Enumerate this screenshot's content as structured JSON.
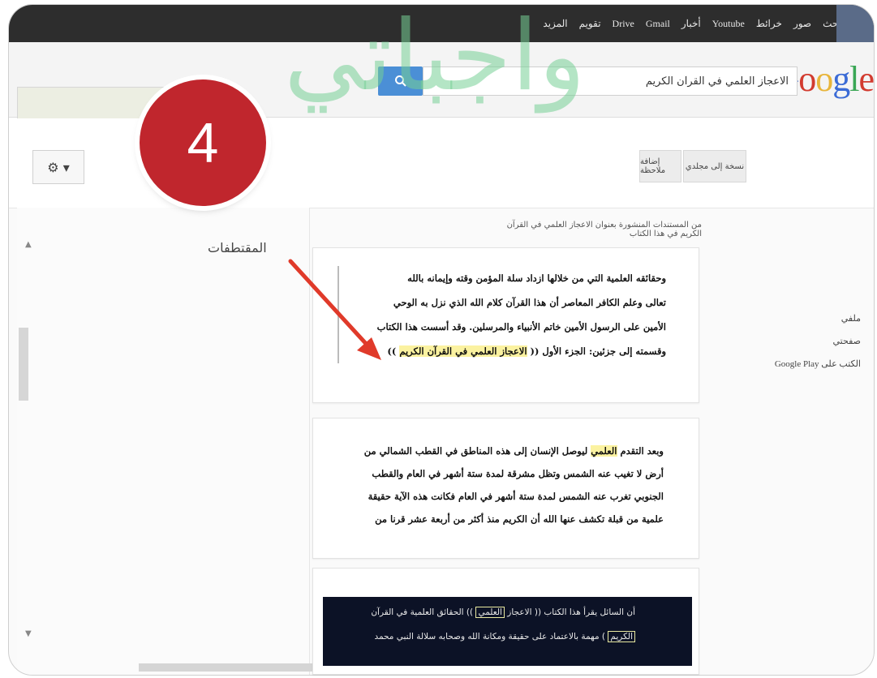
{
  "topbar": {
    "links": [
      "بحث",
      "صور",
      "خرائط",
      "Youtube",
      "أخبار",
      "Gmail",
      "Drive",
      "تقويم",
      "المزيد"
    ]
  },
  "logo": {
    "text": "Google"
  },
  "search": {
    "query": "الاعجاز العلمي في القرآن الكريم"
  },
  "subbar": {
    "chip1": "نسخة إلى مجلدي",
    "chip2": "إضافة ملاحظة",
    "settings": "⚙ ▾"
  },
  "badge": {
    "number": "4"
  },
  "watermark": {
    "text": "واجباتي"
  },
  "left_panel": {
    "snippets_label": "المقتطفات"
  },
  "result": {
    "link": "من المستندات المنشورة بعنوان الاعجاز العلمي في القرآن الكريم في هذا الكتاب",
    "card1": {
      "line1": "وحقائقه العلمية التي من خلالها ازداد سلة المؤمن وقته وإيمانه بالله",
      "line2": "تعالى وعلم الكافر المعاصر أن هذا القرآن كلام الله الذي نزل به الوحي",
      "line3": "الأمين على الرسول الأمين خاتم الأنبياء والمرسلين. وقد أسست هذا الكتاب",
      "line4_a": "وقسمته إلى جزئين: الجزء الأول (( ",
      "line4_hl": "الاعجاز العلمي في القرآن الكريم",
      "line4_b": " ))"
    },
    "card2": {
      "line1_a": "وبعد التقدم ",
      "line1_hl": "العلمي",
      "line1_b": " ليوصل الإنسان إلى هذه المناطق في القطب الشمالي من",
      "line2": "أرض لا تغيب عنه الشمس وتظل مشرقة لمدة ستة أشهر في العام والقطب",
      "line3": "الجنوبي تغرب عنه الشمس لمدة ستة أشهر في العام فكانت هذه الآية حقيقة",
      "line4": "علمية من قبلة تكشف عنها الله أن الكريم منذ أكثر من أربعة عشر قرنا من"
    },
    "card3": {
      "line1_a": "أن السائل يقرأ هذا الكتاب (( الاعجاز ",
      "line1_box": "العلمي",
      "line1_b": " )) الحقائق العلمية في القرآن",
      "line2_box": "الكريم",
      "line2_b": " ) مهمة بالاعتماد على حقيقة ومكانة الله وصحابه سلالة النبي محمد"
    }
  },
  "right_nav": {
    "item1": "ملفي",
    "item2": "صفحتي",
    "item3": "الكتب على Google Play"
  },
  "colors": {
    "badge": "#c0262d",
    "topbar": "#2d2d2d",
    "search_button": "#4b8fd6",
    "highlight": "#fbf2a0",
    "arrow": "#e03a2a"
  }
}
